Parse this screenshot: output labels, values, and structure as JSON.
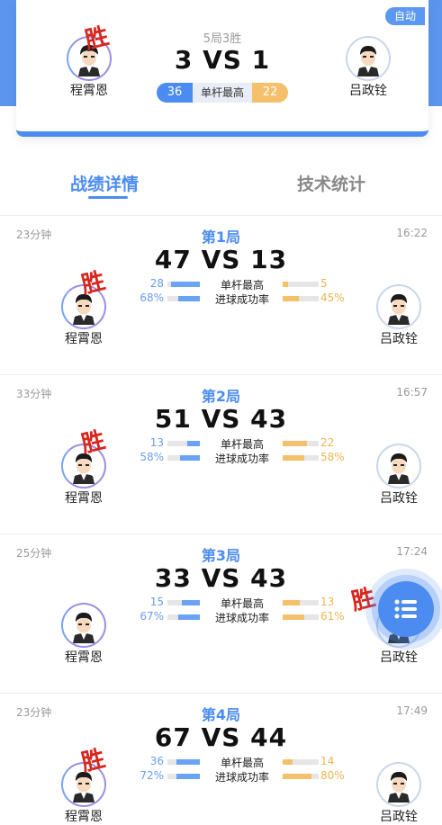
{
  "summary": {
    "mode_badge": "自动",
    "series_format": "5局3胜",
    "series_score": "3 VS 1",
    "best_break_left": "36",
    "best_break_label": "单杆最高",
    "best_break_right": "22",
    "player_left": "程霄恩",
    "player_right": "吕政铨",
    "win_mark": "胜"
  },
  "tabs": {
    "active": "战绩详情",
    "inactive": "技术统计"
  },
  "stat_labels": {
    "best_break": "单杆最高",
    "pot_rate": "进球成功率"
  },
  "games": [
    {
      "duration": "23分钟",
      "title": "第1局",
      "time": "16:22",
      "score": "47 VS 13",
      "best_left": "28",
      "best_right": "5",
      "rate_left": "68%",
      "rate_right": "45%",
      "best_left_frac": 0.9,
      "best_right_frac": 0.15,
      "rate_left_frac": 0.68,
      "rate_right_frac": 0.45,
      "player_left": "程霄恩",
      "player_right": "吕政铨",
      "winner": "left",
      "win_mark": "胜"
    },
    {
      "duration": "33分钟",
      "title": "第2局",
      "time": "16:57",
      "score": "51 VS 43",
      "best_left": "13",
      "best_right": "22",
      "rate_left": "58%",
      "rate_right": "58%",
      "best_left_frac": 0.4,
      "best_right_frac": 0.68,
      "rate_left_frac": 0.6,
      "rate_right_frac": 0.6,
      "player_left": "程霄恩",
      "player_right": "吕政铨",
      "winner": "left",
      "win_mark": "胜"
    },
    {
      "duration": "25分钟",
      "title": "第3局",
      "time": "17:24",
      "score": "33 VS 43",
      "best_left": "15",
      "best_right": "13",
      "rate_left": "67%",
      "rate_right": "61%",
      "best_left_frac": 0.55,
      "best_right_frac": 0.48,
      "rate_left_frac": 0.67,
      "rate_right_frac": 0.61,
      "player_left": "程霄恩",
      "player_right": "吕政铨",
      "winner": "right",
      "win_mark": "胜"
    },
    {
      "duration": "23分钟",
      "title": "第4局",
      "time": "17:49",
      "score": "67 VS 44",
      "best_left": "36",
      "best_right": "14",
      "rate_left": "72%",
      "rate_right": "80%",
      "best_left_frac": 0.72,
      "best_right_frac": 0.28,
      "rate_left_frac": 0.72,
      "rate_right_frac": 0.8,
      "player_left": "程霄恩",
      "player_right": "吕政铨",
      "winner": "left",
      "win_mark": "胜"
    }
  ],
  "colors": {
    "accent": "#4c8cf0",
    "opponent": "#f5c06b",
    "win_mark": "#d7261e"
  },
  "fab_icon": "list-menu-icon"
}
